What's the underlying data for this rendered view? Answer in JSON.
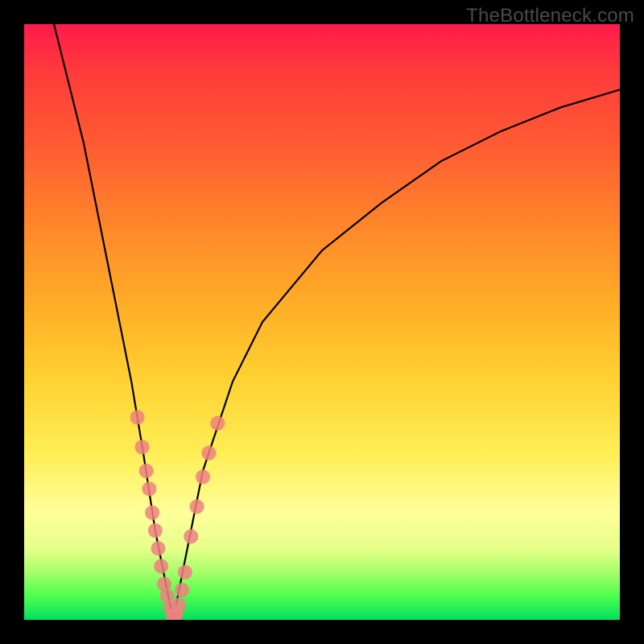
{
  "watermark": "TheBottleneck.com",
  "chart_data": {
    "type": "line",
    "title": "",
    "xlabel": "",
    "ylabel": "",
    "xlim": [
      0,
      100
    ],
    "ylim": [
      0,
      100
    ],
    "background_gradient": {
      "top_color": "#ff1a4d",
      "bottom_color": "#00e060",
      "meaning": "red = high bottleneck, green = low bottleneck"
    },
    "series": [
      {
        "name": "bottleneck-curve",
        "stroke": "#000000",
        "x": [
          5,
          10,
          15,
          18,
          20,
          22,
          24,
          25,
          26,
          28,
          30,
          35,
          40,
          50,
          60,
          70,
          80,
          90,
          100
        ],
        "y": [
          100,
          80,
          55,
          40,
          28,
          15,
          5,
          0,
          5,
          15,
          25,
          40,
          50,
          62,
          70,
          77,
          82,
          86,
          89
        ]
      }
    ],
    "markers": {
      "name": "highlighted-points",
      "color": "#f08080",
      "radius": 9,
      "points": [
        {
          "x": 19.0,
          "y": 34
        },
        {
          "x": 19.8,
          "y": 29
        },
        {
          "x": 20.5,
          "y": 25
        },
        {
          "x": 21.0,
          "y": 22
        },
        {
          "x": 21.5,
          "y": 18
        },
        {
          "x": 22.0,
          "y": 15
        },
        {
          "x": 22.5,
          "y": 12
        },
        {
          "x": 23.0,
          "y": 9
        },
        {
          "x": 23.5,
          "y": 6
        },
        {
          "x": 24.0,
          "y": 4
        },
        {
          "x": 24.5,
          "y": 2
        },
        {
          "x": 25.0,
          "y": 0.5
        },
        {
          "x": 25.5,
          "y": 1
        },
        {
          "x": 26.0,
          "y": 2.5
        },
        {
          "x": 26.5,
          "y": 5
        },
        {
          "x": 27.0,
          "y": 8
        },
        {
          "x": 28.0,
          "y": 14
        },
        {
          "x": 29.0,
          "y": 19
        },
        {
          "x": 30.0,
          "y": 24
        },
        {
          "x": 31.0,
          "y": 28
        },
        {
          "x": 32.5,
          "y": 33
        }
      ]
    }
  }
}
